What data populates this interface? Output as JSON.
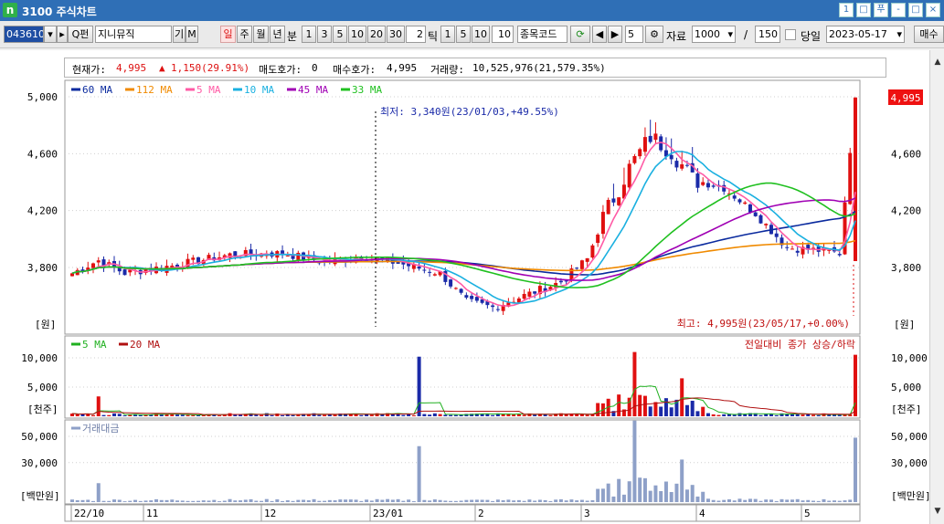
{
  "window": {
    "title": "3100 주식차트",
    "buttons": [
      "1",
      "□",
      "푸",
      "-",
      "□",
      "×"
    ]
  },
  "toolbar": {
    "stock_code": "043610",
    "stock_name": "지니뮤직",
    "ki_label": "기",
    "m_label": "M",
    "period_buttons": [
      "일",
      "주",
      "월",
      "년",
      "분"
    ],
    "active_period": "일",
    "minute_buttons": [
      "1",
      "3",
      "5",
      "10",
      "20",
      "30"
    ],
    "tick_value": "2",
    "tick_label": "틱",
    "tick_buttons": [
      "1",
      "5",
      "10"
    ],
    "tick_input": "10",
    "code_search": "종목코드",
    "step_value": "5",
    "data_label": "자료",
    "data_count": "1000",
    "slash": "/",
    "total_count": "150",
    "today_label": "당일",
    "date": "2023-05-17",
    "buy_button": "매수"
  },
  "infobar": {
    "current_label": "현재가:",
    "current_value": "4,995",
    "change_arrow": "▲",
    "change_value": "1,150(29.91%)",
    "ask_label": "매도호가:",
    "ask_value": "0",
    "bid_label": "매수호가:",
    "bid_value": "4,995",
    "volume_label": "거래량:",
    "volume_value": "10,525,976(21,579.35%)"
  },
  "legends": {
    "price": [
      {
        "label": "60 MA",
        "color": "#0a2a9e"
      },
      {
        "label": "112 MA",
        "color": "#f08a00"
      },
      {
        "label": "5 MA",
        "color": "#ff5aa5"
      },
      {
        "label": "10 MA",
        "color": "#1ab0e0"
      },
      {
        "label": "45 MA",
        "color": "#a000b4"
      },
      {
        "label": "33 MA",
        "color": "#20c020"
      }
    ],
    "volume": [
      {
        "label": "5 MA",
        "color": "#20b020"
      },
      {
        "label": "20 MA",
        "color": "#b01010"
      }
    ],
    "amount": [
      {
        "label": "거래대금",
        "color": "#8ea0c8"
      }
    ]
  },
  "annotations": {
    "low": "최저: 3,340원(23/01/03,+49.55%)",
    "high": "최고: 4,995원(23/05/17,+0.00%)",
    "volume_note": "전일대비 종가 상승/하락",
    "last_price": "4,995"
  },
  "units": {
    "price": "[원]",
    "volume": "[천주]",
    "amount": "[백만원]"
  },
  "axes": {
    "price_ticks": [
      "5,000",
      "4,600",
      "4,200",
      "3,800"
    ],
    "volume_ticks": [
      "10,000",
      "5,000"
    ],
    "amount_ticks": [
      "50,000",
      "30,000"
    ],
    "date_labels": [
      "22/10",
      "11",
      "12",
      "23/01",
      "2",
      "3",
      "4",
      "5"
    ]
  },
  "colors": {
    "up": "#e01010",
    "down": "#1a2aa8",
    "amount_bar": "#8ea0c8",
    "grid": "#d0d0d0"
  },
  "chart_data": {
    "type": "candlestick",
    "x_range": [
      "22/10",
      "23/05/17"
    ],
    "price_range": [
      3340,
      4995
    ],
    "last": {
      "price": 4995,
      "volume_thousand": 10526,
      "amount_million": 49000
    },
    "low_point": {
      "date": "23/01/03",
      "price": 3340
    },
    "high_point": {
      "date": "23/05/17",
      "price": 4995
    },
    "volume_ylim": [
      0,
      12000
    ],
    "amount_ylim": [
      0,
      62000
    ]
  }
}
